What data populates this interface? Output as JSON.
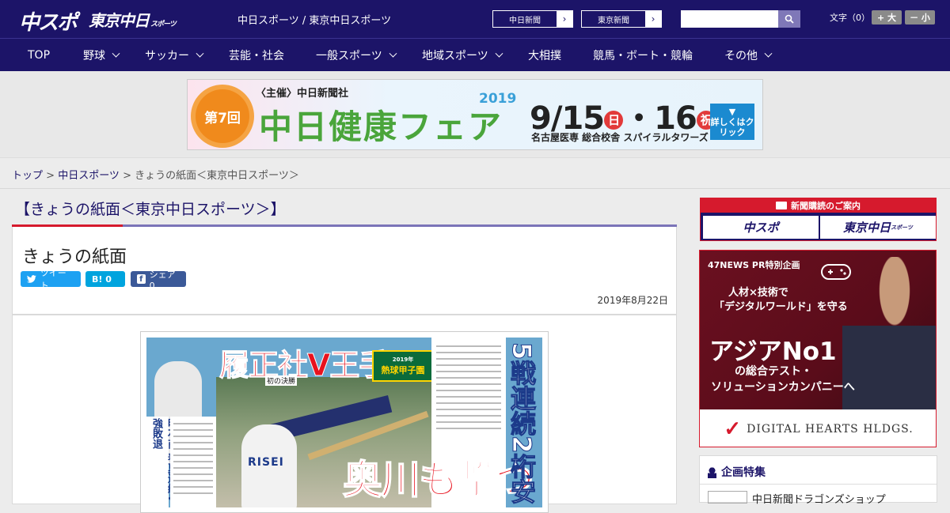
{
  "header": {
    "logo_chuspo": "中スポ",
    "logo_tokyo": "東京中日",
    "logo_tokyo_small": "スポーツ",
    "site_title": "中日スポーツ / 東京中日スポーツ",
    "paper_links": [
      "中日新聞",
      "東京新聞"
    ],
    "search_placeholder": "",
    "fontsize_label": "文字（0）",
    "fontsize_plus": "+ 大",
    "fontsize_minus": "－ 小"
  },
  "nav": {
    "items": [
      "TOP",
      "野球",
      "サッカー",
      "芸能・社会",
      "一般スポーツ",
      "地域スポーツ",
      "大相撲",
      "競馬・ボート・競輪",
      "その他"
    ]
  },
  "banner": {
    "org": "〈主催〉中日新聞社",
    "badge": "第7回",
    "title": "中日健康フェア",
    "year": "2019",
    "date_a": "9/15",
    "dow_a": "日",
    "date_b": "・16",
    "dow_b": "祝",
    "venue": "名古屋医専 総合校舎 スパイラルタワーズ",
    "cta": "詳しくはクリック"
  },
  "breadcrumb": {
    "home": "トップ",
    "sep": " > ",
    "section": "中日スポーツ",
    "current": "きょうの紙面＜東京中日スポーツ＞"
  },
  "main": {
    "section_heading": "【きょうの紙面＜東京中日スポーツ＞】",
    "article_title": "きょうの紙面",
    "share": {
      "tweet": "ツイート",
      "hatena": "B! 0",
      "facebook": "シェア 0"
    },
    "date": "2019年8月22日",
    "paper": {
      "headline1": "履正社V王手",
      "subhead": "初の決勝",
      "badge": "熱球甲子園",
      "badge_sub": "2019年",
      "headline2": "奥川も撃つ",
      "vertical": "5戦連続2桁安",
      "left_vertical": "明石商 春夏連続4強敗退",
      "player_jersey": "RISEI"
    }
  },
  "sidebar": {
    "subscribe_heading": "新聞購読のご案内",
    "subscribe_buttons": [
      "中スポ",
      "東京中日"
    ],
    "subscribe_small": "スポーツ",
    "ad": {
      "label": "47NEWS PR特別企画",
      "copy1": "人材×技術で",
      "copy2": "「デジタルワールド」を守る",
      "big": "アジアNo1",
      "sub1": "の総合テスト・",
      "sub2": "ソリューションカンパニーへ",
      "company": "DIGITAL HEARTS HLDGS."
    },
    "feature": {
      "heading": "企画特集",
      "item": "中日新聞ドラゴンズショップ"
    }
  }
}
